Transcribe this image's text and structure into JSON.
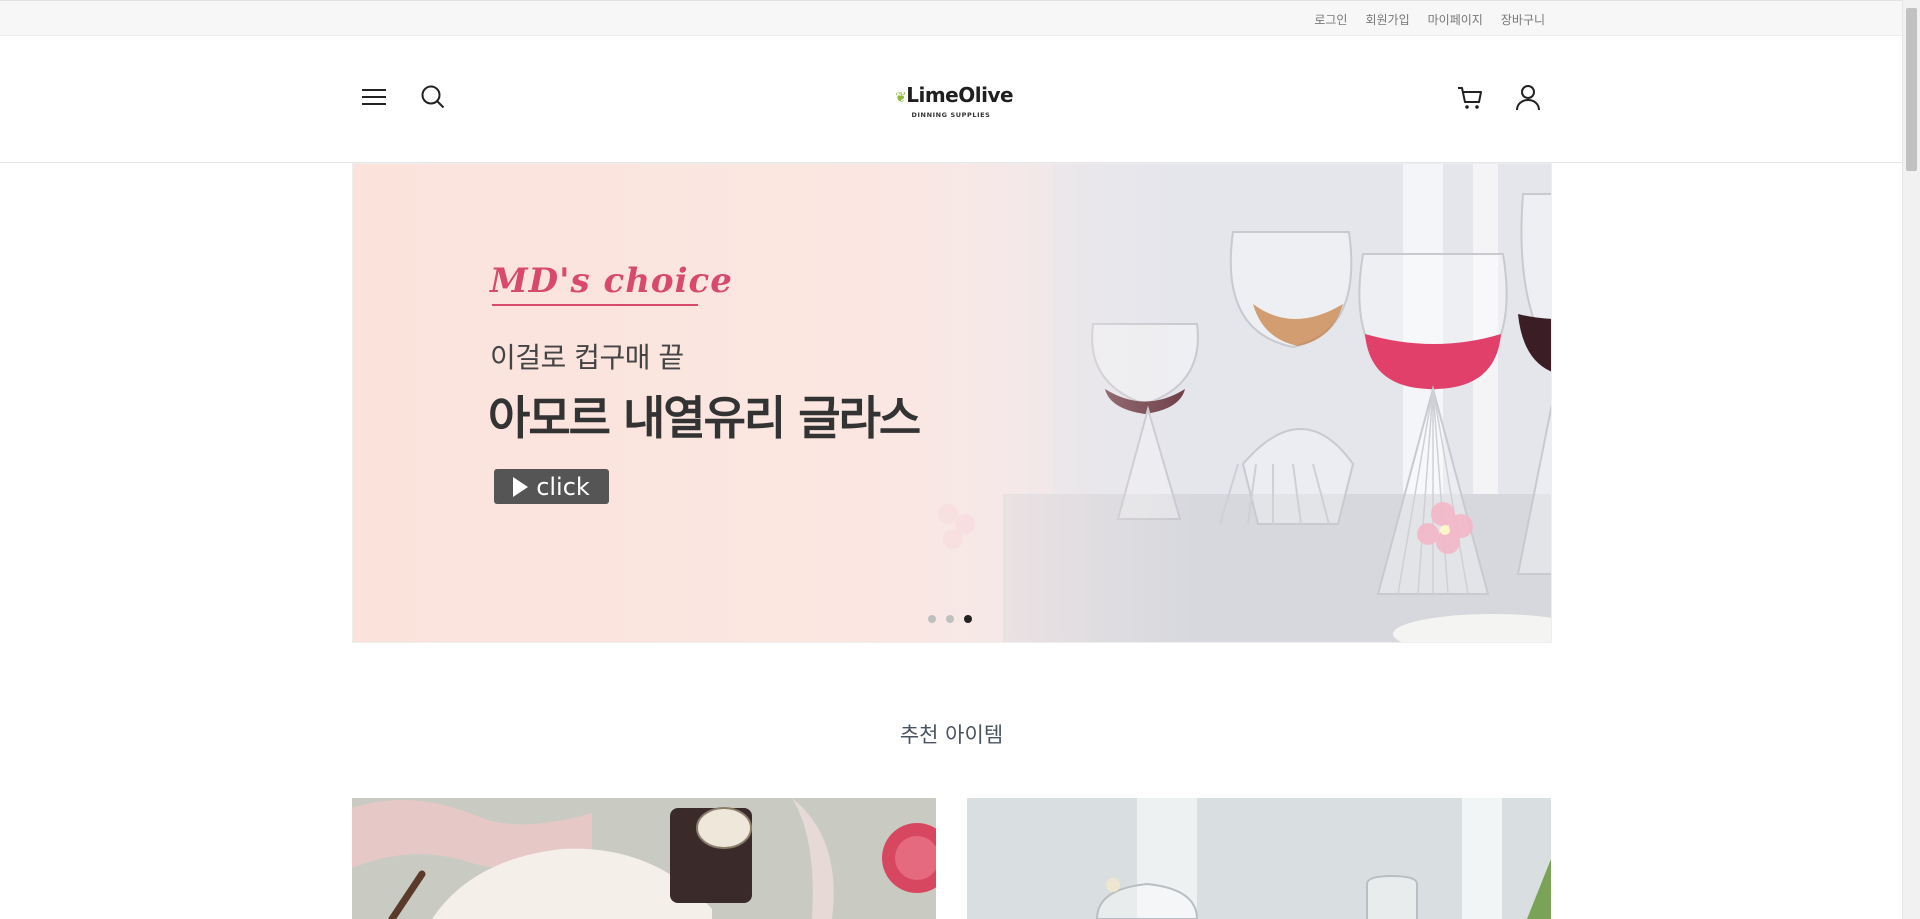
{
  "top_links": [
    "로그인",
    "회원가입",
    "마이페이지",
    "장바구니"
  ],
  "header": {
    "logo_brand": "LimeOlive",
    "logo_tagline": "DINNING SUPPLIES",
    "icons": {
      "menu": "hamburger-menu-icon",
      "search": "search-icon",
      "cart": "cart-icon",
      "user": "user-icon"
    }
  },
  "hero": {
    "script_title": "MD's choice",
    "subtitle": "이걸로 컵구매 끝",
    "title": "아모르 내열유리 글라스",
    "button_label": "click",
    "slides": 3,
    "active_slide": 3,
    "accent_color": "#d84a6c"
  },
  "section": {
    "title": "추천 아이템"
  }
}
